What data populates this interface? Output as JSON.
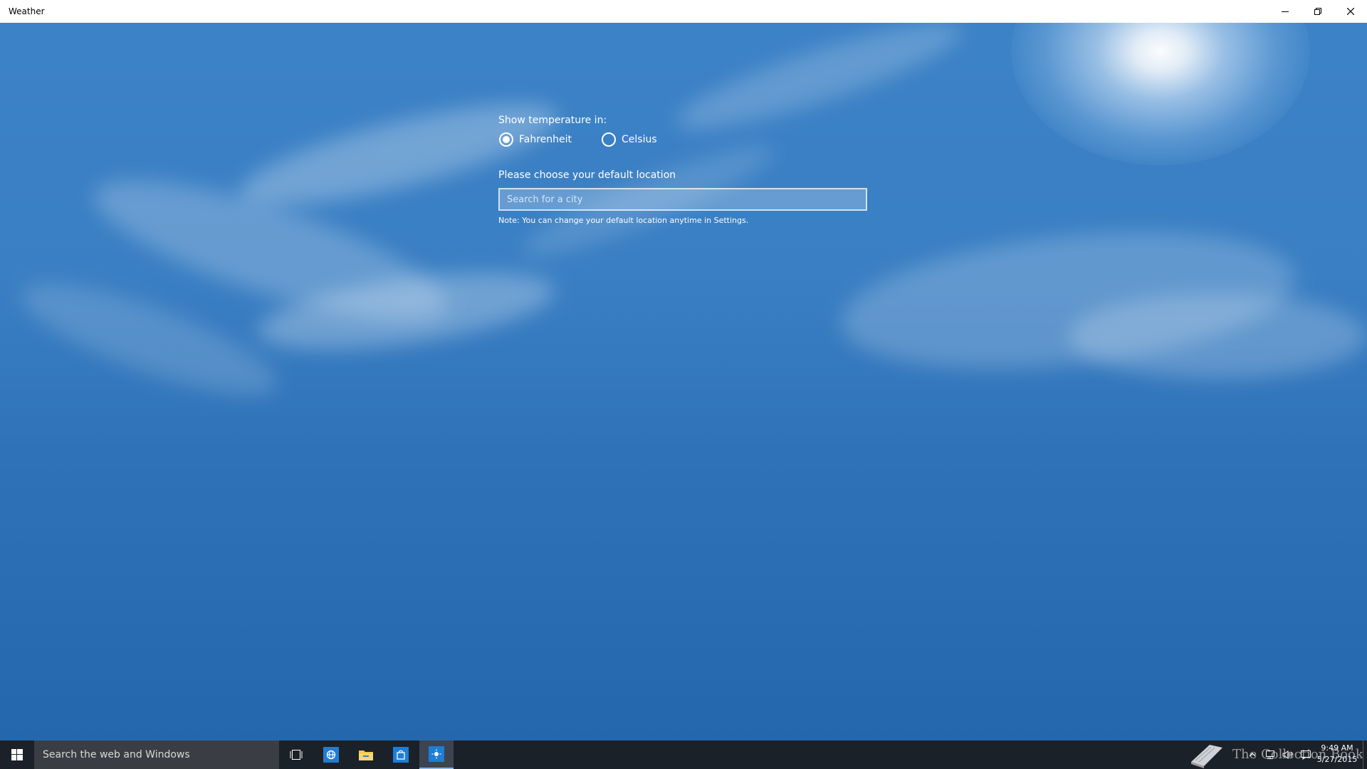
{
  "window": {
    "title": "Weather",
    "controls": {
      "minimize": "minimize-icon",
      "restore": "restore-icon",
      "close": "close-icon"
    }
  },
  "settings": {
    "temperature_label": "Show temperature in:",
    "units": [
      {
        "label": "Fahrenheit",
        "selected": true
      },
      {
        "label": "Celsius",
        "selected": false
      }
    ],
    "location_label": "Please choose your default location",
    "search": {
      "placeholder": "Search for a city",
      "value": ""
    },
    "note": "Note: You can change your default location anytime in Settings."
  },
  "taskbar": {
    "search_placeholder": "Search the web and Windows",
    "pinned": [
      {
        "name": "task-view-icon"
      },
      {
        "name": "internet-explorer-icon"
      },
      {
        "name": "file-explorer-icon"
      },
      {
        "name": "store-icon"
      },
      {
        "name": "weather-app-icon",
        "active": true
      }
    ],
    "watermark": "The Collection Book",
    "time": "9:49 AM",
    "date": "5/27/2015"
  },
  "colors": {
    "sky_top": "#3c82c6",
    "sky_bottom": "#2567ad",
    "taskbar": "#1b2128",
    "accent": "#0078d7"
  }
}
